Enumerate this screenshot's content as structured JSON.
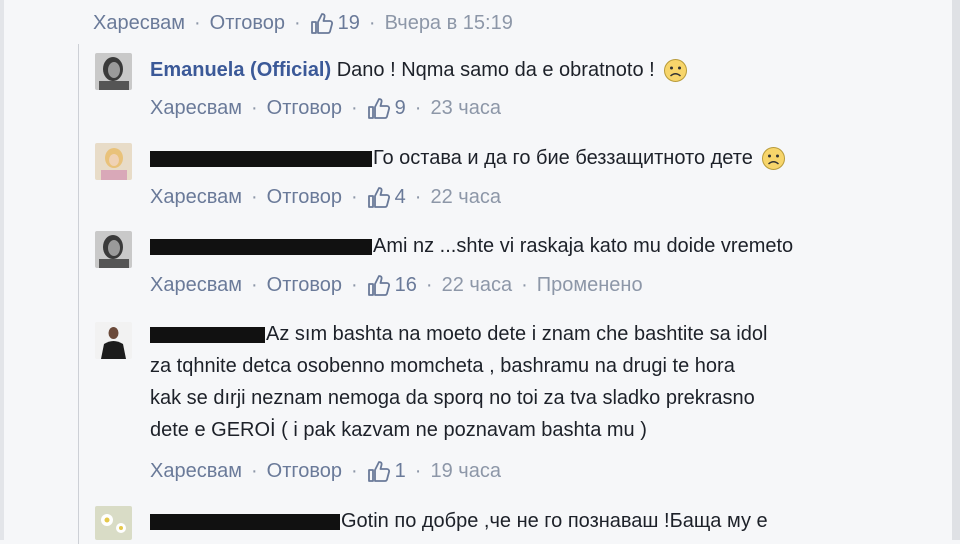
{
  "labels": {
    "like": "Харесвам",
    "reply": "Отговор",
    "separator": "·",
    "edited": "Променено"
  },
  "colors": {
    "link": "#6a7a99",
    "name": "#3b5998",
    "text": "#1d2129",
    "background": "#f6f7f9"
  },
  "top_actions": {
    "likes": "19",
    "time": "Вчера в 15:19"
  },
  "comments": [
    {
      "author": "Emanuela (Official)",
      "text": "Dano ! Nqma samo da e obratnoto !",
      "emoji": "frown-emoji",
      "likes": "9",
      "time": "23 часа"
    },
    {
      "text": "Го остава и да го бие беззащитното дете",
      "emoji": "frown-emoji",
      "likes": "4",
      "time": "22 часа"
    },
    {
      "text": "Ami nz ...shte vi raskaja kato mu doide vremeto",
      "likes": "16",
      "time": "22 часа"
    },
    {
      "lines": [
        "Az sım bashta na moeto dete i znam che bashtite sa idol",
        "za tqhnite detca osobenno momcheta , bashramu na drugi te hora",
        "kak se dırji neznam nemoga da sporq no toi za tva sladko prekrasno",
        "dete e GEROİ ( i pak kazvam ne poznavam bashta mu )"
      ],
      "likes": "1",
      "time": "19 часа"
    },
    {
      "text": "Gotin по добре ,че не го познаваш !Баща му е"
    }
  ]
}
